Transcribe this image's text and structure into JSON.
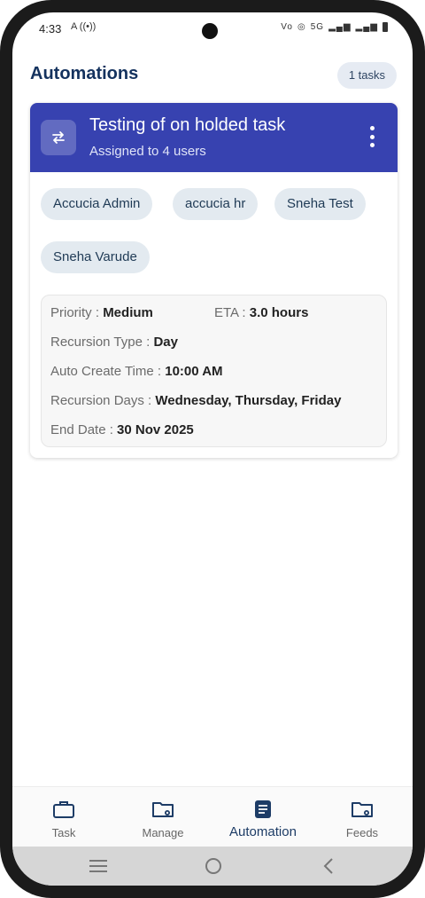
{
  "status_bar": {
    "time": "4:33",
    "left_icons": "A  ((•))",
    "right_icons": [
      "Vo",
      "5G",
      "LTE"
    ]
  },
  "header": {
    "title": "Automations",
    "count_badge": "1 tasks"
  },
  "card": {
    "title": "Testing of on holded task",
    "subtitle": "Assigned to 4 users",
    "icon": "repeat-icon",
    "users": [
      "Accucia Admin",
      "accucia hr",
      "Sneha Test",
      "Sneha Varude"
    ],
    "details": {
      "priority_label": "Priority : ",
      "priority_value": "Medium",
      "eta_label": "ETA : ",
      "eta_value": "3.0 hours",
      "recursion_type_label": "Recursion Type : ",
      "recursion_type_value": "Day",
      "auto_create_label": "Auto Create Time : ",
      "auto_create_value": "10:00 AM",
      "recursion_days_label": "Recursion Days : ",
      "recursion_days_value": "Wednesday, Thursday, Friday",
      "end_date_label": "End Date : ",
      "end_date_value": "30 Nov 2025"
    }
  },
  "bottom_nav": {
    "items": [
      {
        "label": "Task",
        "icon": "briefcase-icon"
      },
      {
        "label": "Manage",
        "icon": "folder-gear-icon"
      },
      {
        "label": "Automation",
        "icon": "document-icon"
      },
      {
        "label": "Feeds",
        "icon": "folder-gear-icon"
      }
    ],
    "active_index": 2
  },
  "colors": {
    "header_text": "#14325e",
    "card_header_bg": "#3742b0",
    "chip_bg": "#e3eaf0",
    "active_nav": "#1d3c66"
  }
}
